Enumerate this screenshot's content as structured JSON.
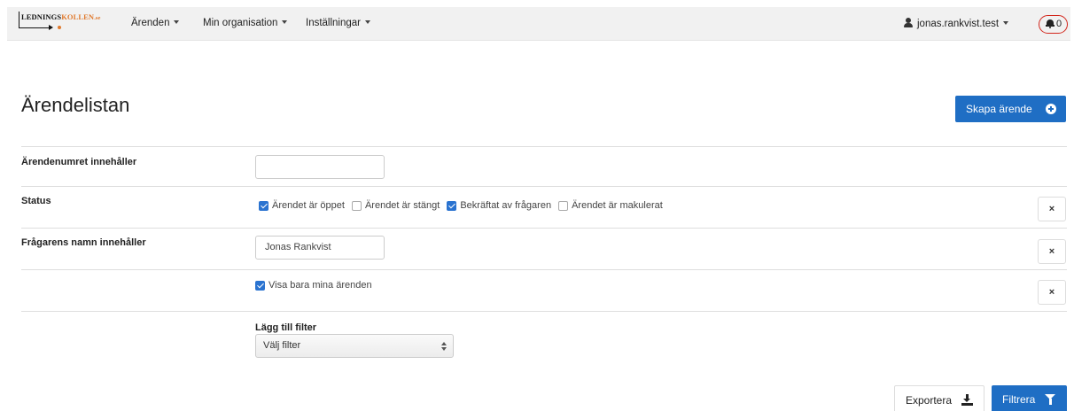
{
  "navbar": {
    "logo_text_main": "LEDNINGS",
    "logo_text_accent": "KOLLEN",
    "logo_text_suffix": ".se",
    "menu": [
      {
        "label": "Ärenden"
      },
      {
        "label": "Min organisation"
      },
      {
        "label": "Inställningar"
      }
    ],
    "user": "jonas.rankvist.test",
    "notification_count": "0"
  },
  "page": {
    "title": "Ärendelistan",
    "create_button": "Skapa ärende"
  },
  "filters": {
    "case_number": {
      "label": "Ärendenumret innehåller",
      "value": ""
    },
    "status": {
      "label": "Status",
      "options": [
        {
          "label": "Ärendet är öppet",
          "checked": true
        },
        {
          "label": "Ärendet är stängt",
          "checked": false
        },
        {
          "label": "Bekräftat av frågaren",
          "checked": true
        },
        {
          "label": "Ärendet är makulerat",
          "checked": false
        }
      ]
    },
    "requester_name": {
      "label": "Frågarens namn innehåller",
      "value": "Jonas Rankvist"
    },
    "only_mine": {
      "label": "Visa bara mina ärenden",
      "checked": true
    },
    "remove_label": "×",
    "add_filter": {
      "label": "Lägg till filter",
      "selected": "Välj filter"
    }
  },
  "actions": {
    "export": "Exportera",
    "filter": "Filtrera"
  },
  "colors": {
    "primary": "#1f6ec4",
    "notification_ring": "#d2261c",
    "logo_accent": "#e07a2e"
  }
}
